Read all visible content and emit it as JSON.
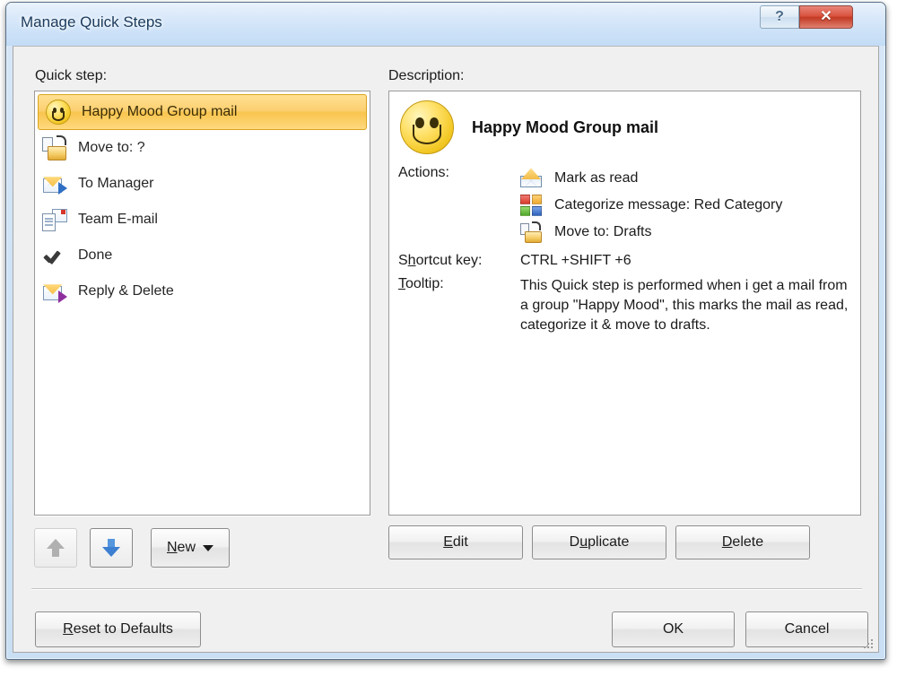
{
  "window": {
    "title": "Manage Quick Steps",
    "help_glyph": "?",
    "close_glyph": "✕"
  },
  "labels": {
    "quick_step": "Quick step:",
    "description": "Description:"
  },
  "quick_steps": [
    {
      "label": "Happy Mood Group mail",
      "icon": "smiley-icon",
      "selected": true
    },
    {
      "label": "Move to: ?",
      "icon": "move-to-folder-icon",
      "selected": false
    },
    {
      "label": "To Manager",
      "icon": "forward-mail-icon",
      "selected": false
    },
    {
      "label": "Team E-mail",
      "icon": "team-email-icon",
      "selected": false
    },
    {
      "label": "Done",
      "icon": "checkmark-icon",
      "selected": false
    },
    {
      "label": "Reply & Delete",
      "icon": "reply-delete-icon",
      "selected": false
    }
  ],
  "description": {
    "title": "Happy Mood Group mail",
    "icon": "smiley-icon",
    "actions_label": "Actions:",
    "actions": [
      {
        "icon": "open-envelope-icon",
        "text": "Mark as read"
      },
      {
        "icon": "categories-icon",
        "text": "Categorize message: Red Category"
      },
      {
        "icon": "move-to-folder-icon",
        "text": "Move to: Drafts"
      }
    ],
    "shortcut_label": "Shortcut key:",
    "shortcut_value": "CTRL +SHIFT +6",
    "tooltip_label": "Tooltip:",
    "tooltip_value": "This Quick step is performed when i get a mail from a group \"Happy Mood\", this marks the mail as read, categorize it & move to drafts."
  },
  "buttons": {
    "edit": "Edit",
    "duplicate": "Duplicate",
    "delete": "Delete",
    "new": "New",
    "move_up": "move-up-icon",
    "move_down": "move-down-icon",
    "reset": "Reset to Defaults",
    "ok": "OK",
    "cancel": "Cancel"
  },
  "colors": {
    "selection": "#f8c54f",
    "title_bar": "#cfe3f6",
    "close_button": "#c33a24",
    "category_red": "#d93b2b"
  }
}
